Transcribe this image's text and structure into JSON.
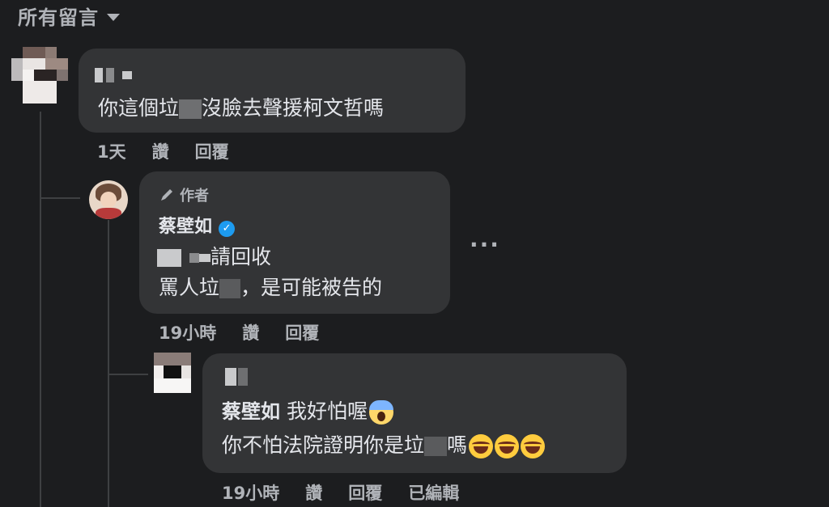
{
  "header": {
    "title": "所有留言"
  },
  "comments": [
    {
      "text_before": "你這個垃",
      "text_after": "沒臉去聲援柯文哲嗎",
      "actions": {
        "time": "1天",
        "like": "讚",
        "reply": "回覆"
      }
    },
    {
      "author_tag": "作者",
      "name": "蔡壁如",
      "line1_after": "請回收",
      "line2_before": "罵人垃",
      "line2_after": "，是可能被告的",
      "actions": {
        "time": "19小時",
        "like": "讚",
        "reply": "回覆"
      },
      "more": "···"
    },
    {
      "mention": "蔡壁如",
      "line1_text": " 我好怕喔",
      "line2_before": "你不怕法院證明你是垃",
      "line2_after": "嗎",
      "actions": {
        "time": "19小時",
        "like": "讚",
        "reply": "回覆",
        "edited": "已編輯"
      }
    }
  ],
  "colors": {
    "background": "#1c1d1f",
    "bubble": "#333436",
    "verified": "#1d9bf0"
  },
  "icons": [
    "chevron-down-icon",
    "pen-icon",
    "verified-badge-icon",
    "more-options-icon",
    "face-screaming-emoji",
    "face-with-tears-of-joy-emoji"
  ]
}
